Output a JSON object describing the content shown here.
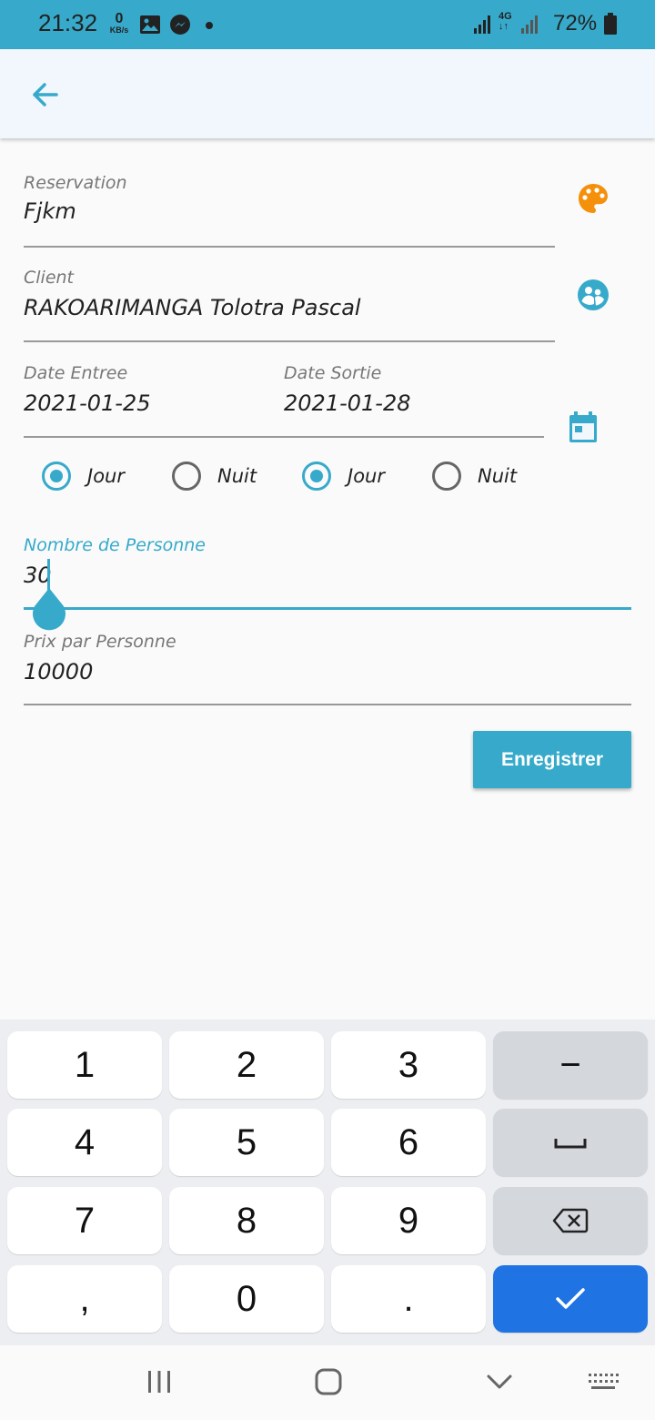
{
  "status_bar": {
    "time": "21:32",
    "data_rate_value": "0",
    "data_rate_unit": "KB/s",
    "network": "4G",
    "battery": "72%",
    "icons": [
      "gallery-icon",
      "messenger-icon",
      "signal-icon",
      "battery-icon"
    ]
  },
  "app_bar": {
    "back_icon": "arrow-left-icon"
  },
  "form": {
    "reservation": {
      "label": "Reservation",
      "value": "Fjkm",
      "icon": "palette-icon"
    },
    "client": {
      "label": "Client",
      "value": "RAKOARIMANGA Tolotra Pascal",
      "icon": "people-icon"
    },
    "date_entree": {
      "label": "Date Entree",
      "value": "2021-01-25"
    },
    "date_sortie": {
      "label": "Date Sortie",
      "value": "2021-01-28"
    },
    "date_icon": "calendar-icon",
    "entree_options": [
      {
        "label": "Jour",
        "selected": true
      },
      {
        "label": "Nuit",
        "selected": false
      }
    ],
    "sortie_options": [
      {
        "label": "Jour",
        "selected": true
      },
      {
        "label": "Nuit",
        "selected": false
      }
    ],
    "nombre_personne": {
      "label": "Nombre de Personne",
      "value": "30"
    },
    "prix_personne": {
      "label": "Prix par Personne",
      "value": "10000"
    },
    "save_label": "Enregistrer"
  },
  "colors": {
    "accent": "#37aacb",
    "palette_icon": "#f5900a",
    "done_key": "#1f73e3"
  },
  "keyboard": {
    "keys": [
      "1",
      "2",
      "3",
      "−",
      "4",
      "5",
      "6",
      "␣",
      "7",
      "8",
      "9",
      "⌫",
      ",",
      "0",
      ".",
      "✓"
    ]
  },
  "nav_bar": {
    "icons": [
      "recents-icon",
      "home-icon",
      "back-icon",
      "keyboard-switch-icon"
    ]
  }
}
